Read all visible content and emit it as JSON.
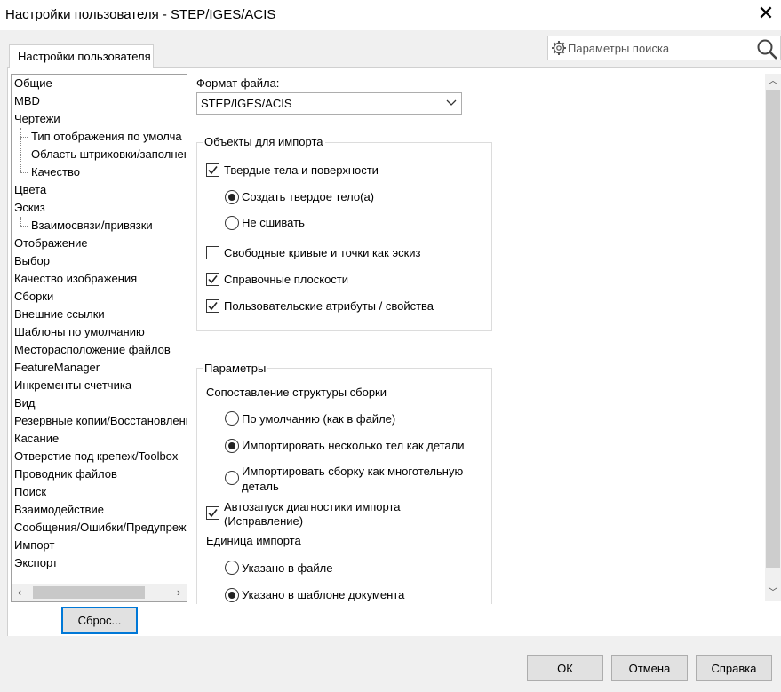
{
  "window": {
    "title": "Настройки пользователя - STEP/IGES/ACIS",
    "tab_label": "Настройки пользователя"
  },
  "search": {
    "placeholder": "Параметры поиска"
  },
  "tree": {
    "items": [
      "Общие",
      "MBD",
      "Чертежи",
      "Тип отображения по умолча",
      "Область штриховки/заполнени",
      "Качество",
      "Цвета",
      "Эскиз",
      "Взаимосвязи/привязки",
      "Отображение",
      "Выбор",
      "Качество изображения",
      "Сборки",
      "Внешние ссылки",
      "Шаблоны по умолчанию",
      "Месторасположение файлов",
      "FeatureManager",
      "Инкременты счетчика",
      "Вид",
      "Резервные копии/Восстановлени",
      "Касание",
      "Отверстие под крепеж/Toolbox",
      "Проводник файлов",
      "Поиск",
      "Взаимодействие",
      "Сообщения/Ошибки/Предупреж",
      "Импорт",
      "Экспорт"
    ]
  },
  "reset_button": "Сброс...",
  "file_format": {
    "label": "Формат файла:",
    "value": "STEP/IGES/ACIS"
  },
  "import_objects": {
    "title": "Объекты для импорта",
    "solids": "Твердые тела и поверхности",
    "create_solid": "Создать твердое тело(а)",
    "no_knit": "Не сшивать",
    "free_curves": "Свободные кривые и точки как эскиз",
    "ref_planes": "Справочные плоскости",
    "user_attrs": "Пользовательские атрибуты / свойства"
  },
  "params": {
    "title": "Параметры",
    "assembly_mapping": "Сопоставление структуры сборки",
    "default": "По умолчанию (как в файле)",
    "multi_bodies": "Импортировать несколько тел как детали",
    "assembly_as_part_1": "Импортировать сборку как многотельную",
    "assembly_as_part_2": "деталь",
    "autorun_1": "Автозапуск диагностики импорта",
    "autorun_2": "(Исправление)",
    "import_unit": "Единица импорта",
    "in_file": "Указано в файле",
    "in_template": "Указано в шаблоне документа"
  },
  "buttons": {
    "ok": "ОК",
    "cancel": "Отмена",
    "help": "Справка"
  }
}
